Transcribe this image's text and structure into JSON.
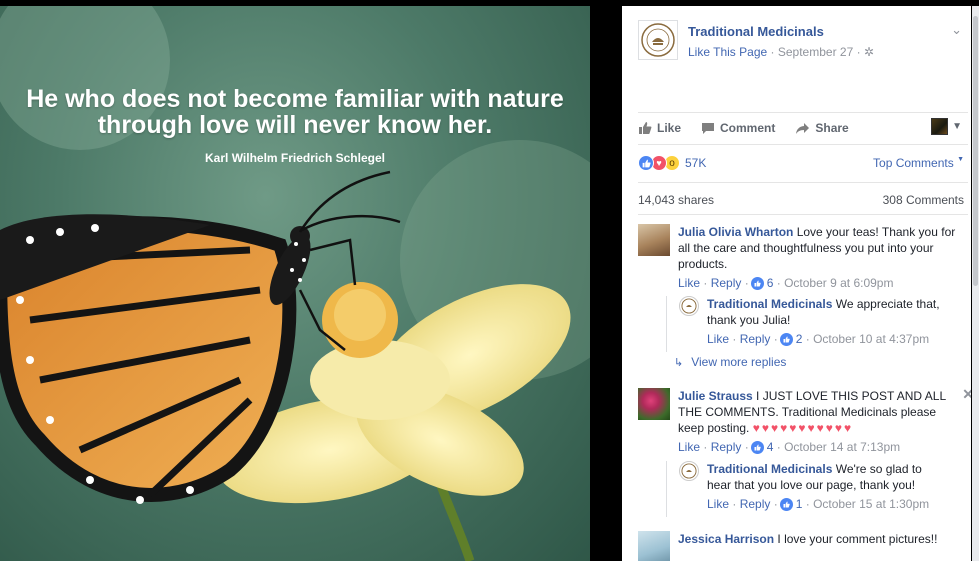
{
  "photo": {
    "quote_line1": "He who does not become familiar with nature",
    "quote_line2": "through love will never know her.",
    "author": "Karl Wilhelm Friedrich Schlegel"
  },
  "post": {
    "page_name": "Traditional Medicinals",
    "like_page": "Like This Page",
    "date": "September 27",
    "audience_icon": "globe-icon",
    "chevron_icon": "chevron-down-icon"
  },
  "actions": {
    "like": "Like",
    "comment": "Comment",
    "share": "Share"
  },
  "reactions": {
    "count": "57K",
    "types": [
      "like",
      "love",
      "wow"
    ],
    "sort_label": "Top Comments"
  },
  "stats": {
    "shares": "14,043 shares",
    "comments": "308 Comments"
  },
  "comments": [
    {
      "author": "Julia Olivia Wharton",
      "text": "Love your teas! Thank you for all the care and thoughtfulness you put into your products.",
      "like_label": "Like",
      "reply_label": "Reply",
      "likes": "6",
      "time": "October 9 at 6:09pm",
      "reply": {
        "author": "Traditional Medicinals",
        "text": "We appreciate that, thank you Julia!",
        "like_label": "Like",
        "reply_label": "Reply",
        "likes": "2",
        "time": "October 10 at 4:37pm"
      },
      "more_replies": "View more replies"
    },
    {
      "author": "Julie Strauss",
      "text": "I JUST LOVE THIS POST AND ALL THE COMMENTS. Traditional Medicinals please keep posting.",
      "hearts": "♥♥♥♥♥♥♥♥♥♥♥",
      "like_label": "Like",
      "reply_label": "Reply",
      "likes": "4",
      "time": "October 14 at 7:13pm",
      "reply": {
        "author": "Traditional Medicinals",
        "text": "We're so glad to hear that you love our page, thank you!",
        "like_label": "Like",
        "reply_label": "Reply",
        "likes": "1",
        "time": "October 15 at 1:30pm"
      }
    },
    {
      "author": "Jessica Harrison",
      "text": "I love your comment pictures!!"
    }
  ],
  "colors": {
    "link_blue": "#4267b2",
    "name_blue": "#365899",
    "grey": "#90949c",
    "like_blue": "#4c86f3",
    "love_red": "#f25268"
  }
}
